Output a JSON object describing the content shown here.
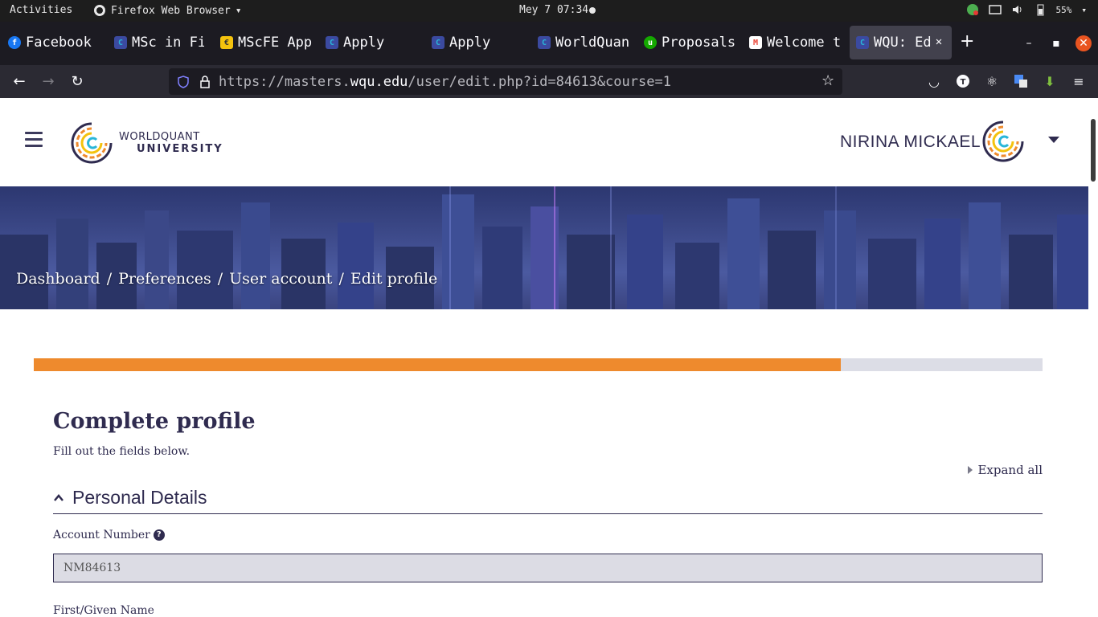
{
  "system_bar": {
    "activities": "Activities",
    "app_name": "Firefox Web Browser",
    "clock": "Mey 7 07:34",
    "battery": "55%"
  },
  "tabs": [
    {
      "title": "Facebook",
      "favicon": "facebook-icon",
      "color": "#1877f2"
    },
    {
      "title": "MSc in Fi",
      "favicon": "wqu-icon",
      "color": "#3b4aa0"
    },
    {
      "title": "MScFE App",
      "favicon": "mail-icon",
      "color": "#f4c20d"
    },
    {
      "title": "Apply",
      "favicon": "wqu-icon",
      "color": "#3b4aa0"
    },
    {
      "title": "Apply",
      "favicon": "wqu-icon",
      "color": "#3b4aa0"
    },
    {
      "title": "WorldQuan",
      "favicon": "wqu-icon",
      "color": "#3b4aa0"
    },
    {
      "title": "Proposals",
      "favicon": "upwork-icon",
      "color": "#14a800"
    },
    {
      "title": "Welcome t",
      "favicon": "gmail-icon",
      "color": "#ea4335"
    },
    {
      "title": "WQU: Ed",
      "favicon": "wqu-icon",
      "color": "#3b4aa0",
      "active": true
    }
  ],
  "navbar": {
    "url_prefix": "https://masters.",
    "url_domain": "wqu.edu",
    "url_suffix": "/user/edit.php?id=84613&course=1"
  },
  "header": {
    "logo_line1": "WORLDQUANT",
    "logo_line2": "UNIVERSITY",
    "user_name": "NIRINA MICKAEL"
  },
  "breadcrumb": [
    "Dashboard",
    "Preferences",
    "User account",
    "Edit profile"
  ],
  "progress": {
    "percent": 80
  },
  "form": {
    "title": "Complete profile",
    "subtitle": "Fill out the fields below.",
    "expand_all": "Expand all",
    "section_title": "Personal Details",
    "account_label": "Account Number",
    "account_value": "NM84613",
    "first_name_label": "First/Given Name"
  },
  "colors": {
    "accent_orange": "#ee8a2d",
    "brand_navy": "#2f2b4f",
    "brand_cyan": "#29b6d8"
  }
}
